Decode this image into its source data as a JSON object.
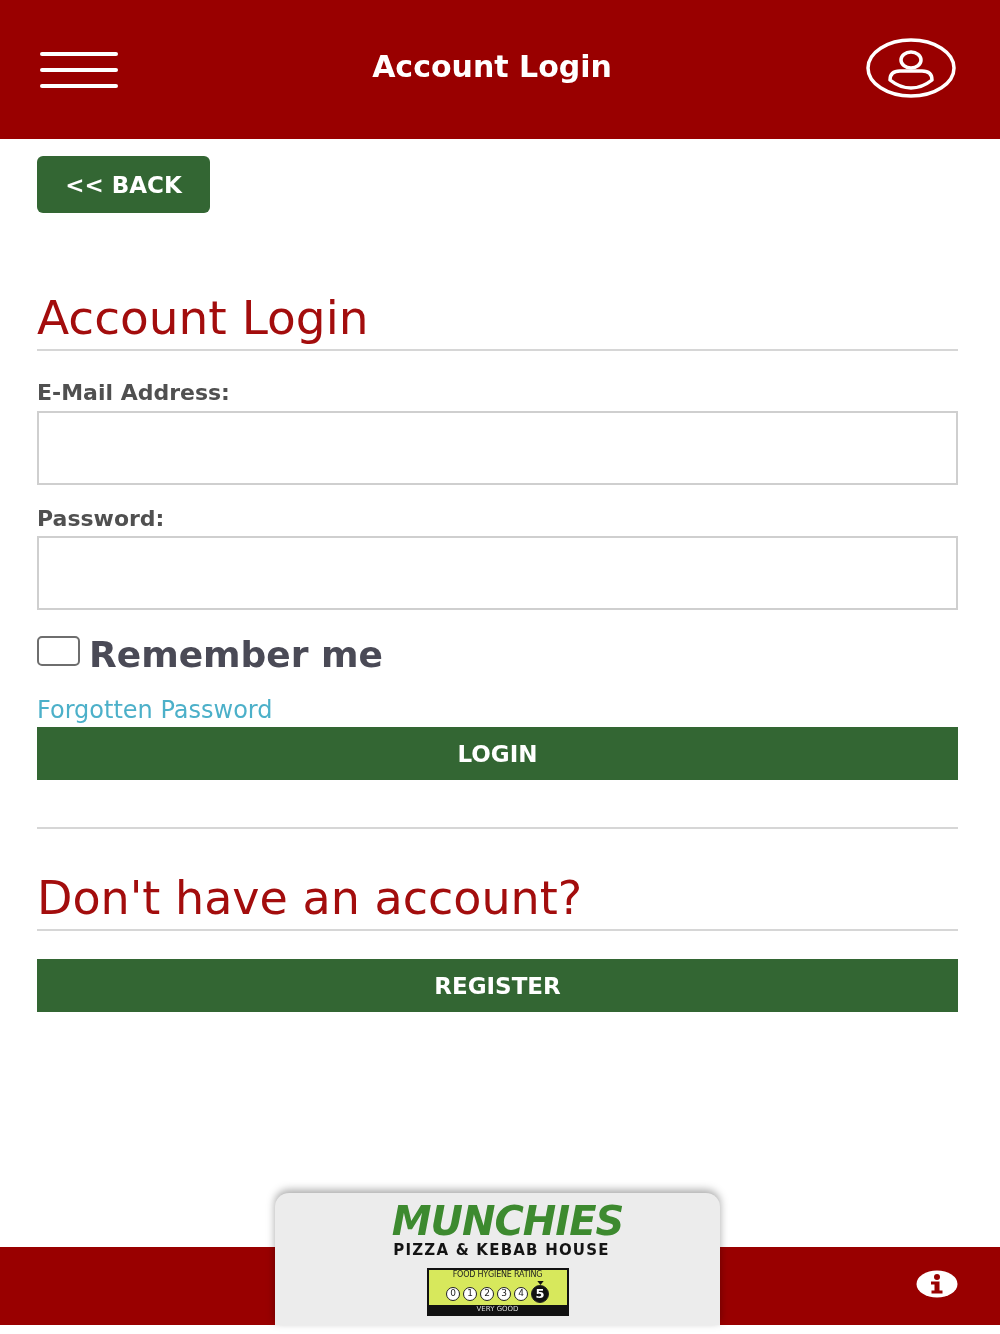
{
  "header": {
    "title": "Account Login"
  },
  "back_button": {
    "label": "<< BACK"
  },
  "login_form": {
    "heading": "Account Login",
    "fields": [
      {
        "label": "E-Mail Address:"
      },
      {
        "label": "Password:"
      }
    ],
    "remember_me": {
      "label": "Remember me",
      "checked": false
    },
    "forgot_link": "Forgotten Password",
    "submit_button": "LOGIN"
  },
  "register": {
    "heading": "Don't have an account?",
    "button": "REGISTER"
  },
  "footer": {
    "logo": {
      "name": "MUNCHIES",
      "tagline": "PIZZA & KEBAB HOUSE"
    },
    "hygiene_rating": {
      "title": "FOOD HYGIENE RATING",
      "scores": [
        {
          "label": "0",
          "selected": false
        },
        {
          "label": "1",
          "selected": false
        },
        {
          "label": "2",
          "selected": false
        },
        {
          "label": "3",
          "selected": false
        },
        {
          "label": "4",
          "selected": false
        },
        {
          "label": "5",
          "selected": true
        }
      ],
      "verdict": "VERY GOOD"
    }
  }
}
